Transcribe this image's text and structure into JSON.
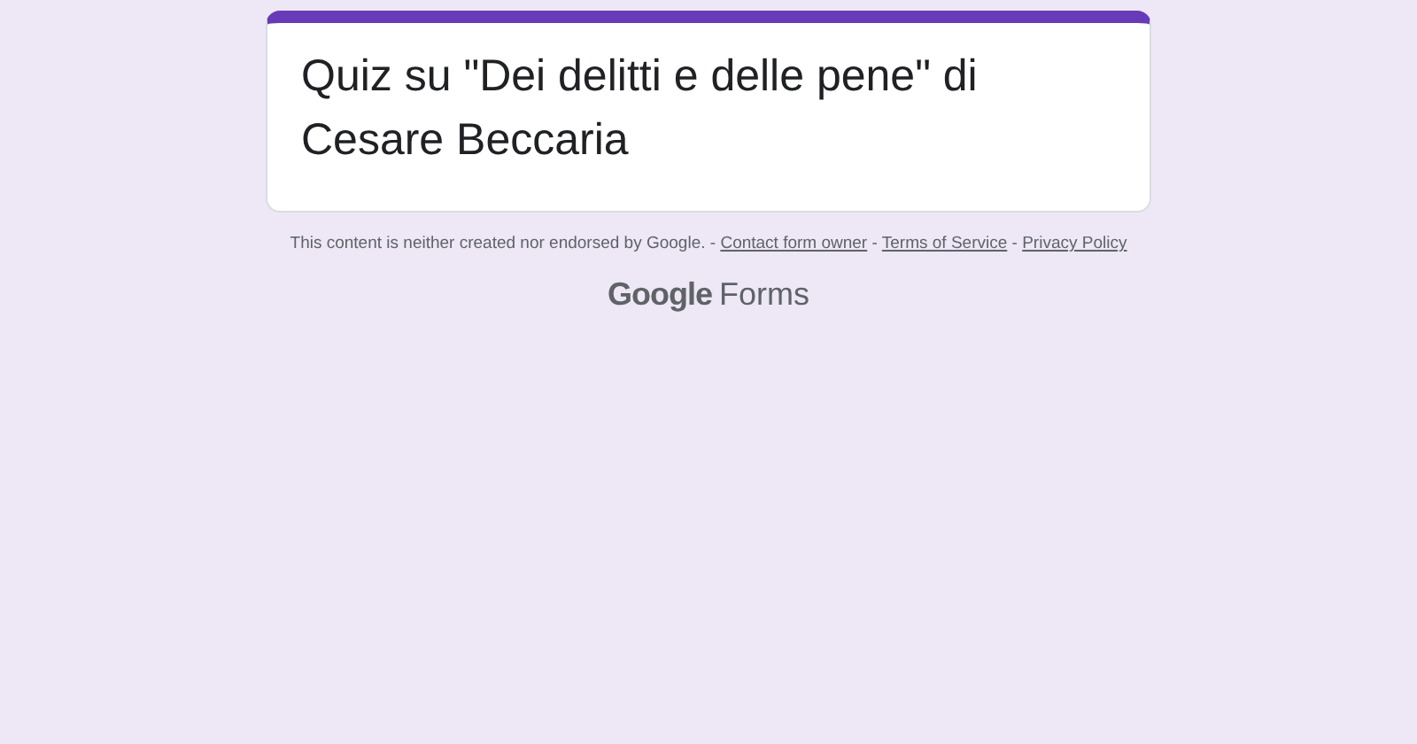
{
  "form": {
    "title": "Quiz su \"Dei delitti e delle pene\" di Cesare Beccaria"
  },
  "footer": {
    "disclaimer": "This content is neither created nor endorsed by Google.",
    "separator": "-",
    "links": [
      "Contact form owner",
      "Terms of Service",
      "Privacy Policy"
    ]
  },
  "logo": {
    "brand": "Google",
    "product": "Forms"
  }
}
